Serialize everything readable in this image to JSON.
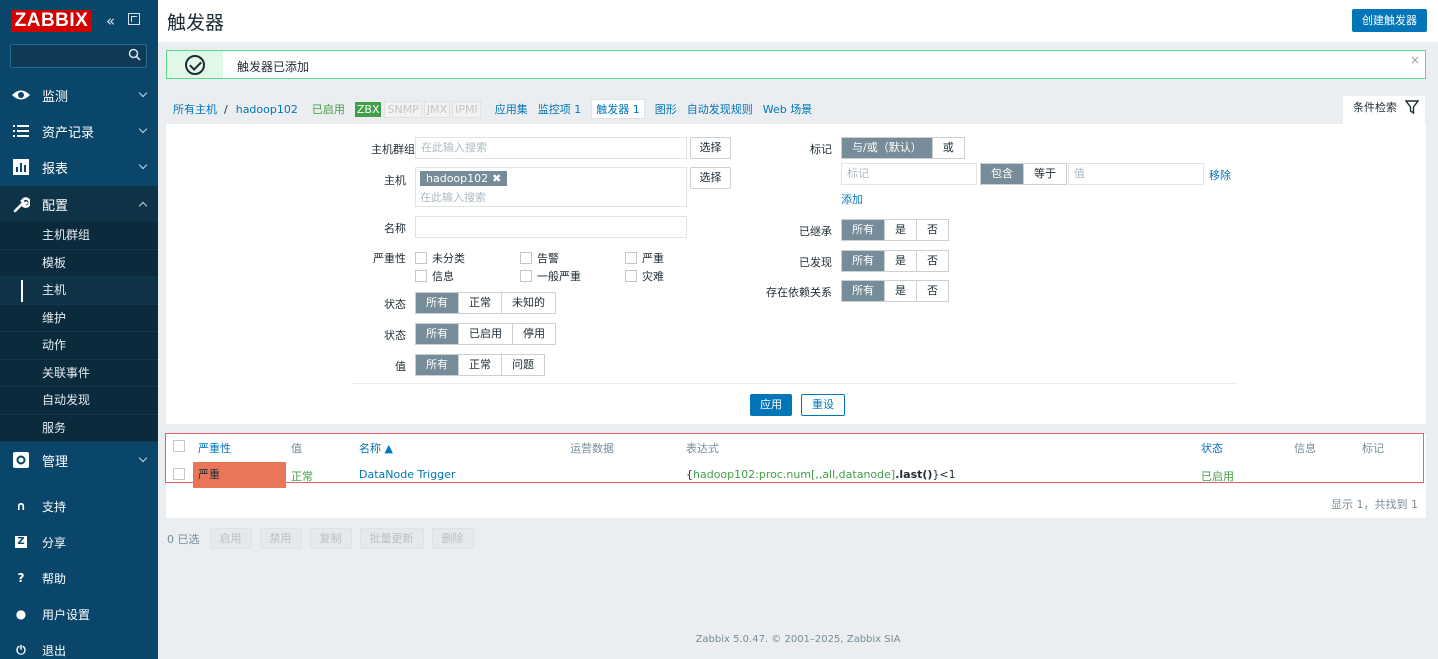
{
  "sidebar": {
    "logo": "ZABBIX",
    "menu": [
      {
        "label": "监测",
        "icon": "eye-icon"
      },
      {
        "label": "资产记录",
        "icon": "list-icon"
      },
      {
        "label": "报表",
        "icon": "bar-chart-icon"
      },
      {
        "label": "配置",
        "icon": "wrench-icon"
      }
    ],
    "config_sub": [
      "主机群组",
      "模板",
      "主机",
      "维护",
      "动作",
      "关联事件",
      "自动发现",
      "服务"
    ],
    "admin": {
      "label": "管理",
      "icon": "gear-box-icon"
    },
    "bottom": [
      {
        "label": "支持",
        "icon": "headset-icon",
        "glyph": "∩"
      },
      {
        "label": "分享",
        "icon": "share-icon",
        "glyph": "Z"
      },
      {
        "label": "帮助",
        "icon": "help-icon",
        "glyph": "?"
      },
      {
        "label": "用户设置",
        "icon": "user-icon",
        "glyph": "●"
      },
      {
        "label": "退出",
        "icon": "power-icon",
        "glyph": "⏻"
      }
    ]
  },
  "header": {
    "title": "触发器",
    "create_button": "创建触发器"
  },
  "message": {
    "text": "触发器已添加",
    "close": "×"
  },
  "nav": {
    "all_hosts": "所有主机",
    "separator": "/",
    "host": "hadoop102",
    "enabled": "已启用",
    "zbx": "ZBX",
    "snmp": "SNMP",
    "jmx": "JMX",
    "ipmi": "IPMI",
    "applications": "应用集",
    "items": "监控项 1",
    "triggers": "触发器 1",
    "graphs": "图形",
    "discovery": "自动发现规则",
    "web": "Web 场景"
  },
  "filter": {
    "tab_label": "条件检索",
    "host_group_label": "主机群组",
    "host_group_placeholder": "在此输入搜索",
    "select": "选择",
    "host_label": "主机",
    "host_tag": "hadoop102",
    "host_tag_remove": "✖",
    "host_placeholder": "在此输入搜索",
    "name_label": "名称",
    "severity_label": "严重性",
    "severities": [
      "未分类",
      "告警",
      "严重",
      "信息",
      "一般严重",
      "灾难"
    ],
    "state_label": "状态",
    "state_options": [
      "所有",
      "正常",
      "未知的"
    ],
    "status_label": "状态",
    "status_options": [
      "所有",
      "已启用",
      "停用"
    ],
    "value_label": "值",
    "value_options": [
      "所有",
      "正常",
      "问题"
    ],
    "tags_label": "标记",
    "tags_eval": [
      "与/或（默认）",
      "或"
    ],
    "tag_placeholder": "标记",
    "tag_ops": [
      "包含",
      "等于"
    ],
    "value_placeholder": "值",
    "remove": "移除",
    "add": "添加",
    "inherited_label": "已继承",
    "discovered_label": "已发现",
    "dependencies_label": "存在依赖关系",
    "yes_no": [
      "所有",
      "是",
      "否"
    ],
    "apply": "应用",
    "reset": "重设"
  },
  "table": {
    "headers": {
      "severity": "严重性",
      "value": "值",
      "name": "名称 ▲",
      "operational": "运营数据",
      "expression": "表达式",
      "status": "状态",
      "info": "信息",
      "tags": "标记"
    },
    "rows": [
      {
        "severity": "严重",
        "value": "正常",
        "name": "DataNode Trigger",
        "expr_open": "{",
        "expr_item": "hadoop102:proc.num[,,all,datanode]",
        "expr_func": ".last()",
        "expr_close": "}<1",
        "status": "已启用"
      }
    ],
    "footer": "显示 1，共找到 1"
  },
  "actions": {
    "selected": "0 已选",
    "buttons": [
      "启用",
      "禁用",
      "复制",
      "批量更新",
      "删除"
    ]
  },
  "copyright": "Zabbix 5.0.47. © 2001–2025, Zabbix SIA",
  "colors": {
    "brand": "#d40000",
    "sidebar": "#0a466a",
    "accent": "#0275b8",
    "green": "#429e47",
    "high_severity": "#e97659"
  }
}
